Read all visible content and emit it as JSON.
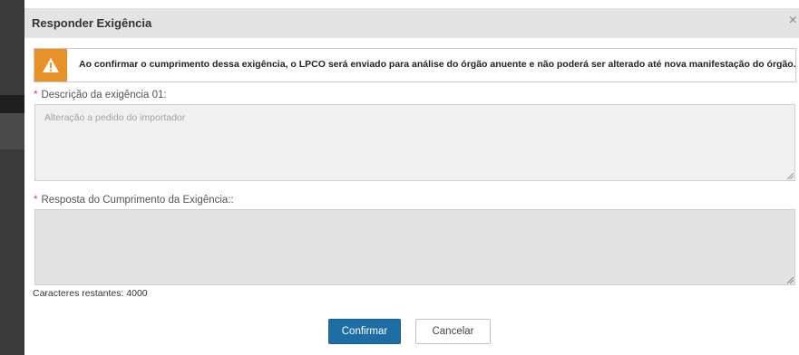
{
  "modal": {
    "title": "Responder Exigência",
    "close_glyph": "×"
  },
  "alert": {
    "icon": "warning-triangle-icon",
    "color": "#e8912a",
    "text": "Ao confirmar o cumprimento dessa exigência, o LPCO será enviado para análise do órgão anuente e não poderá ser alterado até nova manifestação do órgão."
  },
  "fields": {
    "descricao": {
      "required_mark": "*",
      "label": "Descrição da exigência 01:",
      "value": "Alteração a pedido do importador"
    },
    "resposta": {
      "required_mark": "*",
      "label": "Resposta do Cumprimento da Exigência::",
      "value": ""
    }
  },
  "counter": "Caracteres restantes: 4000",
  "buttons": {
    "confirm": "Confirmar",
    "cancel": "Cancelar"
  },
  "colors": {
    "primary": "#1d6ea5",
    "warning": "#e8912a",
    "required": "#e03c3c"
  }
}
